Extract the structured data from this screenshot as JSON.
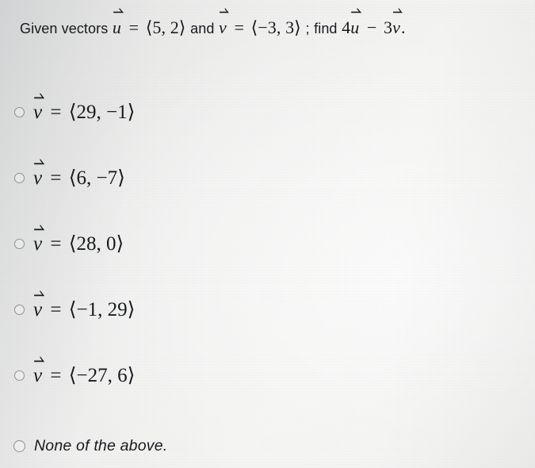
{
  "question": {
    "lead": "Given vectors",
    "u_symbol": "u",
    "eq1": "=",
    "u_value": "⟨5, 2⟩",
    "conj": "and",
    "v_symbol": "v",
    "eq2": "=",
    "v_value": "⟨−3, 3⟩",
    "separator": ";",
    "find_word": "find",
    "expr_coef1": "4",
    "expr_var1": "u",
    "expr_op": "−",
    "expr_coef2": "3",
    "expr_var2": "v",
    "expr_period": ".",
    "full_text": "Given vectors u⃗ = ⟨5, 2⟩ and v⃗ = ⟨−3, 3⟩; find 4u⃗ − 3v⃗."
  },
  "options": [
    {
      "id": "option-1",
      "symbol": "v",
      "equals": "=",
      "value": "⟨29, −1⟩",
      "selected": false,
      "kind": "math"
    },
    {
      "id": "option-2",
      "symbol": "v",
      "equals": "=",
      "value": "⟨6, −7⟩",
      "selected": false,
      "kind": "math"
    },
    {
      "id": "option-3",
      "symbol": "v",
      "equals": "=",
      "value": "⟨28, 0⟩",
      "selected": false,
      "kind": "math"
    },
    {
      "id": "option-4",
      "symbol": "v",
      "equals": "=",
      "value": "⟨−1, 29⟩",
      "selected": false,
      "kind": "math"
    },
    {
      "id": "option-5",
      "symbol": "v",
      "equals": "=",
      "value": "⟨−27, 6⟩",
      "selected": false,
      "kind": "math"
    },
    {
      "id": "option-6",
      "label": "None of the above.",
      "selected": false,
      "kind": "text"
    }
  ],
  "colors": {
    "text": "#171a1d",
    "radio_border": "#8d9195",
    "page_light": "#f6f6f4",
    "page_shadow": "#dedede"
  }
}
